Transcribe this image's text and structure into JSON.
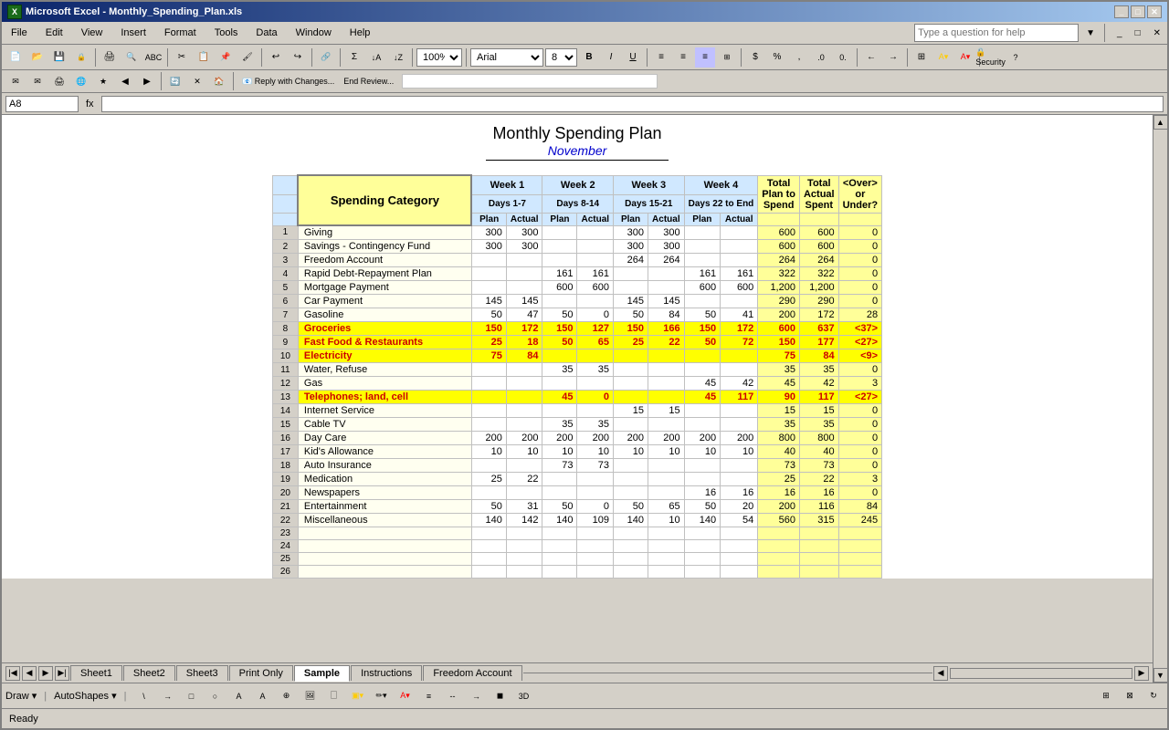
{
  "window": {
    "title": "Microsoft Excel - Monthly_Spending_Plan.xls",
    "icon": "XL"
  },
  "menus": [
    "File",
    "Edit",
    "View",
    "Insert",
    "Format",
    "Tools",
    "Data",
    "Window",
    "Help"
  ],
  "formula_bar": {
    "name_box": "A8",
    "formula": ""
  },
  "sheet": {
    "title": "Monthly Spending Plan",
    "subtitle": "November"
  },
  "toolbar2": {
    "reply_button": "Reply with Changes...",
    "end_review": "End Review..."
  },
  "ask_question": "Type a question for help",
  "zoom": "100%",
  "font": "Arial",
  "font_size": "8",
  "headers": {
    "category": "Spending Category",
    "week1": {
      "label": "Week 1",
      "days": "Days 1-7"
    },
    "week2": {
      "label": "Week 2",
      "days": "Days 8-14"
    },
    "week3": {
      "label": "Week 3",
      "days": "Days 15-21"
    },
    "week4": {
      "label": "Week 4",
      "days": "Days 22 to End"
    },
    "total_plan": "Total Plan to Spend",
    "total_actual": "Total Actual Spent",
    "over_under": "<Over> or Under?"
  },
  "rows": [
    {
      "num": 1,
      "category": "Giving",
      "w1p": 300,
      "w1a": 300,
      "w2p": "",
      "w2a": "",
      "w3p": 300,
      "w3a": 300,
      "w4p": "",
      "w4a": "",
      "tp": 600,
      "ta": 600,
      "ou": 0,
      "style": "normal"
    },
    {
      "num": 2,
      "category": "Savings - Contingency Fund",
      "w1p": 300,
      "w1a": 300,
      "w2p": "",
      "w2a": "",
      "w3p": 300,
      "w3a": 300,
      "w4p": "",
      "w4a": "",
      "tp": 600,
      "ta": 600,
      "ou": 0,
      "style": "normal"
    },
    {
      "num": 3,
      "category": "Freedom Account",
      "w1p": "",
      "w1a": "",
      "w2p": "",
      "w2a": "",
      "w3p": 264,
      "w3a": 264,
      "w4p": "",
      "w4a": "",
      "tp": 264,
      "ta": 264,
      "ou": 0,
      "style": "normal"
    },
    {
      "num": 4,
      "category": "Rapid Debt-Repayment Plan",
      "w1p": "",
      "w1a": "",
      "w2p": 161,
      "w2a": 161,
      "w3p": "",
      "w3a": "",
      "w4p": 161,
      "w4a": 161,
      "tp": 322,
      "ta": 322,
      "ou": 0,
      "style": "normal"
    },
    {
      "num": 5,
      "category": "Mortgage Payment",
      "w1p": "",
      "w1a": "",
      "w2p": 600,
      "w2a": 600,
      "w3p": "",
      "w3a": "",
      "w4p": 600,
      "w4a": 600,
      "tp": "1,200",
      "ta": "1,200",
      "ou": 0,
      "style": "normal"
    },
    {
      "num": 6,
      "category": "Car Payment",
      "w1p": 145,
      "w1a": 145,
      "w2p": "",
      "w2a": "",
      "w3p": 145,
      "w3a": 145,
      "w4p": "",
      "w4a": "",
      "tp": 290,
      "ta": 290,
      "ou": 0,
      "style": "normal"
    },
    {
      "num": 7,
      "category": "Gasoline",
      "w1p": 50,
      "w1a": 47,
      "w2p": 50,
      "w2a": 0,
      "w3p": 50,
      "w3a": 84,
      "w4p": 50,
      "w4a": 41,
      "tp": 200,
      "ta": 172,
      "ou": 28,
      "style": "normal"
    },
    {
      "num": 8,
      "category": "Groceries",
      "w1p": 150,
      "w1a": 172,
      "w2p": 150,
      "w2a": 127,
      "w3p": 150,
      "w3a": 166,
      "w4p": 150,
      "w4a": 172,
      "tp": 600,
      "ta": 637,
      "ou": "<37>",
      "style": "yellow"
    },
    {
      "num": 9,
      "category": "Fast Food & Restaurants",
      "w1p": 25,
      "w1a": 18,
      "w2p": 50,
      "w2a": 65,
      "w3p": 25,
      "w3a": 22,
      "w4p": 50,
      "w4a": 72,
      "tp": 150,
      "ta": 177,
      "ou": "<27>",
      "style": "yellow"
    },
    {
      "num": 10,
      "category": "Electricity",
      "w1p": 75,
      "w1a": 84,
      "w2p": "",
      "w2a": "",
      "w3p": "",
      "w3a": "",
      "w4p": "",
      "w4a": "",
      "tp": 75,
      "ta": 84,
      "ou": "<9>",
      "style": "yellow"
    },
    {
      "num": 11,
      "category": "Water, Refuse",
      "w1p": "",
      "w1a": "",
      "w2p": 35,
      "w2a": 35,
      "w3p": "",
      "w3a": "",
      "w4p": "",
      "w4a": "",
      "tp": 35,
      "ta": 35,
      "ou": 0,
      "style": "normal"
    },
    {
      "num": 12,
      "category": "Gas",
      "w1p": "",
      "w1a": "",
      "w2p": "",
      "w2a": "",
      "w3p": "",
      "w3a": "",
      "w4p": 45,
      "w4a": 42,
      "tp": 45,
      "ta": 42,
      "ou": 3,
      "style": "normal"
    },
    {
      "num": 13,
      "category": "Telephones; land, cell",
      "w1p": "",
      "w1a": "",
      "w2p": 45,
      "w2a": 0,
      "w3p": "",
      "w3a": "",
      "w4p": 45,
      "w4a": 117,
      "tp": 90,
      "ta": 117,
      "ou": "<27>",
      "style": "yellow"
    },
    {
      "num": 14,
      "category": "Internet Service",
      "w1p": "",
      "w1a": "",
      "w2p": "",
      "w2a": "",
      "w3p": 15,
      "w3a": 15,
      "w4p": "",
      "w4a": "",
      "tp": 15,
      "ta": 15,
      "ou": 0,
      "style": "normal"
    },
    {
      "num": 15,
      "category": "Cable TV",
      "w1p": "",
      "w1a": "",
      "w2p": 35,
      "w2a": 35,
      "w3p": "",
      "w3a": "",
      "w4p": "",
      "w4a": "",
      "tp": 35,
      "ta": 35,
      "ou": 0,
      "style": "normal"
    },
    {
      "num": 16,
      "category": "Day Care",
      "w1p": 200,
      "w1a": 200,
      "w2p": 200,
      "w2a": 200,
      "w3p": 200,
      "w3a": 200,
      "w4p": 200,
      "w4a": 200,
      "tp": 800,
      "ta": 800,
      "ou": 0,
      "style": "normal"
    },
    {
      "num": 17,
      "category": "Kid's Allowance",
      "w1p": 10,
      "w1a": 10,
      "w2p": 10,
      "w2a": 10,
      "w3p": 10,
      "w3a": 10,
      "w4p": 10,
      "w4a": 10,
      "tp": 40,
      "ta": 40,
      "ou": 0,
      "style": "normal"
    },
    {
      "num": 18,
      "category": "Auto Insurance",
      "w1p": "",
      "w1a": "",
      "w2p": 73,
      "w2a": 73,
      "w3p": "",
      "w3a": "",
      "w4p": "",
      "w4a": "",
      "tp": 73,
      "ta": 73,
      "ou": 0,
      "style": "normal"
    },
    {
      "num": 19,
      "category": "Medication",
      "w1p": 25,
      "w1a": 22,
      "w2p": "",
      "w2a": "",
      "w3p": "",
      "w3a": "",
      "w4p": "",
      "w4a": "",
      "tp": 25,
      "ta": 22,
      "ou": 3,
      "style": "normal"
    },
    {
      "num": 20,
      "category": "Newspapers",
      "w1p": "",
      "w1a": "",
      "w2p": "",
      "w2a": "",
      "w3p": "",
      "w3a": "",
      "w4p": 16,
      "w4a": 16,
      "tp": 16,
      "ta": 16,
      "ou": 0,
      "style": "normal"
    },
    {
      "num": 21,
      "category": "Entertainment",
      "w1p": 50,
      "w1a": 31,
      "w2p": 50,
      "w2a": 0,
      "w3p": 50,
      "w3a": 65,
      "w4p": 50,
      "w4a": 20,
      "tp": 200,
      "ta": 116,
      "ou": 84,
      "style": "normal"
    },
    {
      "num": 22,
      "category": "Miscellaneous",
      "w1p": 140,
      "w1a": 142,
      "w2p": 140,
      "w2a": 109,
      "w3p": 140,
      "w3a": 10,
      "w4p": 140,
      "w4a": 54,
      "tp": 560,
      "ta": 315,
      "ou": 245,
      "style": "normal"
    },
    {
      "num": 23,
      "category": "",
      "w1p": "",
      "w1a": "",
      "w2p": "",
      "w2a": "",
      "w3p": "",
      "w3a": "",
      "w4p": "",
      "w4a": "",
      "tp": "",
      "ta": "",
      "ou": "",
      "style": "normal"
    },
    {
      "num": 24,
      "category": "",
      "w1p": "",
      "w1a": "",
      "w2p": "",
      "w2a": "",
      "w3p": "",
      "w3a": "",
      "w4p": "",
      "w4a": "",
      "tp": "",
      "ta": "",
      "ou": "",
      "style": "normal"
    },
    {
      "num": 25,
      "category": "",
      "w1p": "",
      "w1a": "",
      "w2p": "",
      "w2a": "",
      "w3p": "",
      "w3a": "",
      "w4p": "",
      "w4a": "",
      "tp": "",
      "ta": "",
      "ou": "",
      "style": "normal"
    },
    {
      "num": 26,
      "category": "",
      "w1p": "",
      "w1a": "",
      "w2p": "",
      "w2a": "",
      "w3p": "",
      "w3a": "",
      "w4p": "",
      "w4a": "",
      "tp": "",
      "ta": "",
      "ou": "",
      "style": "normal"
    }
  ],
  "tabs": [
    "Sheet1",
    "Sheet2",
    "Sheet3",
    "Print Only",
    "Sample",
    "Instructions",
    "Freedom Account"
  ],
  "active_tab": "Sample",
  "status": "Ready",
  "draw_items": [
    "Draw ▾",
    "AutoShapes ▾"
  ],
  "col_headers": [
    "Plan",
    "Actual",
    "Plan",
    "Actual",
    "Plan",
    "Actual",
    "Plan",
    "Actual"
  ]
}
